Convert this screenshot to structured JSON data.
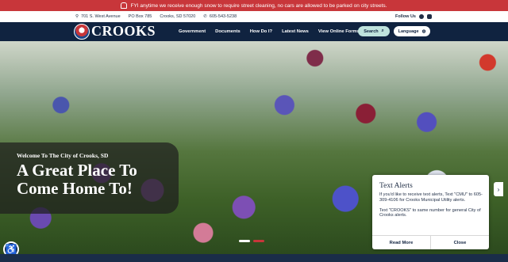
{
  "alert": {
    "text": "FYI anytime we receive enough snow to require street cleaning, no cars are allowed to be parked on city streets."
  },
  "info": {
    "address": "701 S. West Avenue",
    "po_box": "PO Box 785",
    "city": "Crooks, SD 57020",
    "phone": "605-543-5238",
    "follow_label": "Follow Us"
  },
  "header": {
    "logo_text": "CROOKS",
    "nav": [
      "Government",
      "Documents",
      "How Do I?",
      "Latest News",
      "View Online Forms"
    ],
    "search_label": "Search",
    "language_label": "Language"
  },
  "hero": {
    "subtitle": "Welcome To The City of Crooks, SD",
    "title": "A Great Place To Come Home To!"
  },
  "popup": {
    "title": "Text Alerts",
    "body1": "If you'd like to receive text alerts, Text \"CMU\" to 605-309-4106 for Crooks Municipal Utility alerts.",
    "body2": "Text \"CROOKS\" to same number for general City of Crooks alerts.",
    "read_more": "Read More",
    "close": "Close"
  },
  "colors": {
    "navy": "#102340",
    "alert_red": "#c8363a",
    "mint": "#bfe3dd"
  }
}
